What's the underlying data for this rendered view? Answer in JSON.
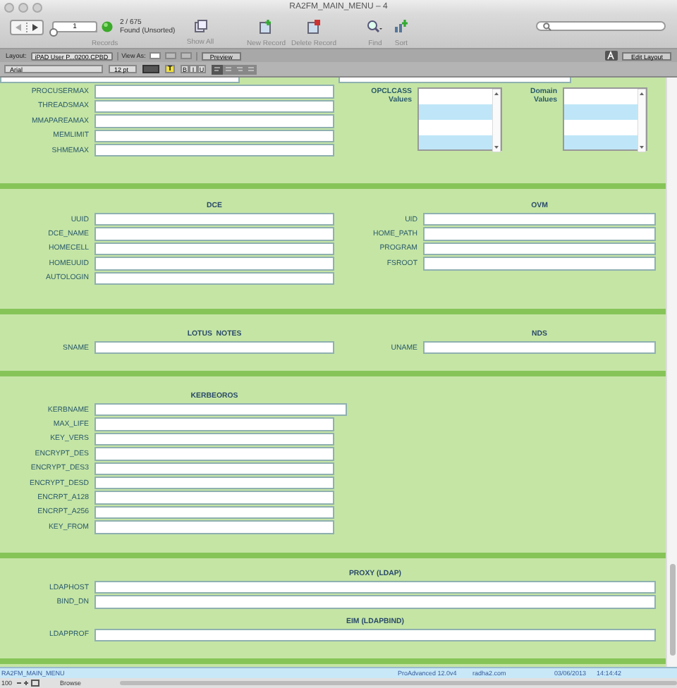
{
  "window": {
    "title": "RA2FM_MAIN_MENU – 4"
  },
  "toolbar": {
    "record_number": "1",
    "record_count": "2 / 675",
    "found_status": "Found (Unsorted)",
    "records_label": "Records",
    "slider": {
      "level": 0
    },
    "buttons": [
      {
        "label": "Show All",
        "kind": "show-all"
      },
      {
        "label": "New Record",
        "kind": "new-record"
      },
      {
        "label": "Delete Record",
        "kind": "delete-record"
      },
      {
        "label": "Find",
        "kind": "find"
      },
      {
        "label": "Sort",
        "kind": "sort"
      }
    ]
  },
  "layout_bar": {
    "layout_label": "Layout:",
    "layout_value": "iPAD User P...0200.CPBD",
    "view_as_label": "View As:",
    "view_modes": [
      {
        "selected": true
      },
      {
        "selected": false
      },
      {
        "selected": false
      }
    ],
    "preview": "Preview",
    "edit_layout": "Edit Layout"
  },
  "format_bar": {
    "font": "Arial",
    "size": "12 pt",
    "highlight": "T",
    "styles": [
      "B",
      "I",
      "U"
    ]
  },
  "sections": [
    {
      "columns": [
        {
          "fields": [
            {
              "label": "PROCUSERMAX"
            },
            {
              "label": "THREADSMAX"
            },
            {
              "label": "MMAPAREAMAX"
            },
            {
              "label": "MEMLIMIT"
            },
            {
              "label": "SHMEMAX"
            }
          ]
        },
        {
          "lists": [
            {
              "label": "OPCLCASS Values"
            },
            {
              "label": "Domain Values"
            }
          ]
        }
      ]
    },
    {
      "columns": [
        {
          "heading": "DCE",
          "fields": [
            {
              "label": "UUID"
            },
            {
              "label": "DCE_NAME"
            },
            {
              "label": "HOMECELL"
            },
            {
              "label": "HOMEUUID"
            },
            {
              "label": "AUTOLOGIN"
            }
          ]
        },
        {
          "heading": "OVM",
          "fields": [
            {
              "label": "UID"
            },
            {
              "label": "HOME_PATH"
            },
            {
              "label": "PROGRAM"
            },
            {
              "label": "FSROOT"
            }
          ]
        }
      ]
    },
    {
      "columns": [
        {
          "heading": "LOTUS  NOTES",
          "fields": [
            {
              "label": "SNAME"
            }
          ]
        },
        {
          "heading": "NDS",
          "fields": [
            {
              "label": "UNAME"
            }
          ]
        }
      ]
    },
    {
      "columns": [
        {
          "heading": "KERBEOROS",
          "fields": [
            {
              "label": "KERBNAME",
              "kind": "wide"
            },
            {
              "label": "MAX_LIFE"
            },
            {
              "label": "KEY_VERS"
            },
            {
              "label": "ENCRYPT_DES"
            },
            {
              "label": "ENCRYPT_DES3"
            },
            {
              "label": "ENCRYPT_DESD"
            },
            {
              "label": "ENCRPT_A128"
            },
            {
              "label": "ENCRPT_A256"
            },
            {
              "label": "KEY_FROM"
            }
          ]
        }
      ]
    },
    {
      "columns": [
        {
          "kind": "full",
          "heading": "PROXY (LDAP)",
          "fields": [
            {
              "label": "LDAPHOST",
              "kind": "wide"
            },
            {
              "label": "BIND_DN",
              "kind": "wide"
            }
          ]
        },
        {
          "kind": "full",
          "heading": "EIM (LDAPBIND)",
          "fields": [
            {
              "label": "LDAPPROF",
              "kind": "wide"
            }
          ]
        }
      ]
    }
  ],
  "status_bar": {
    "layout_name": "RA2FM_MAIN_MENU",
    "version": "ProAdvanced 12.0v4",
    "site": "radha2.com",
    "date": "03/06/2013",
    "time": "14:14:42"
  },
  "bottom_bar": {
    "zoom": "100",
    "mode": "Browse"
  }
}
